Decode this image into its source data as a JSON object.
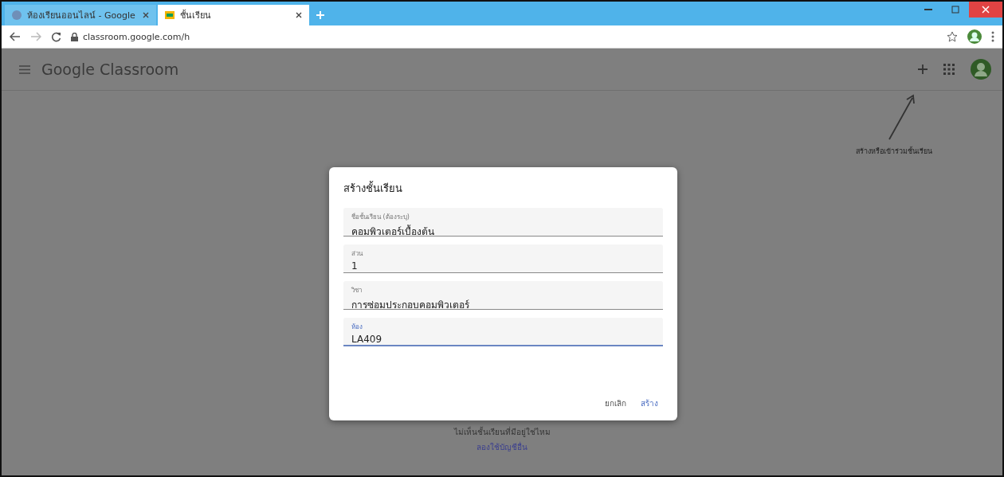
{
  "browser": {
    "tabs": [
      {
        "title": "ห้องเรียนออนไลน์ - Google",
        "selected": false
      },
      {
        "title": "ชั้นเรียน",
        "selected": true
      }
    ],
    "url": "classroom.google.com/h"
  },
  "app_bar": {
    "title": "Google Classroom"
  },
  "annotation": {
    "text": "สร้างหรือเข้าร่วมชั้นเรียน"
  },
  "empty_state": {
    "message": "ไม่เห็นชั้นเรียนที่มีอยู่ใช่ไหม",
    "link": "ลองใช้บัญชีอื่น"
  },
  "dialog": {
    "title": "สร้างชั้นเรียน",
    "fields": [
      {
        "label": "ชื่อชั้นเรียน (ต้องระบุ)",
        "value": "คอมพิวเตอร์เบื้องต้น",
        "focused": false
      },
      {
        "label": "ส่วน",
        "value": "1",
        "focused": false
      },
      {
        "label": "วิชา",
        "value": "การซ่อมประกอบคอมพิวเตอร์",
        "focused": false
      },
      {
        "label": "ห้อง",
        "value": "LA409",
        "focused": true
      }
    ],
    "buttons": [
      "ยกเลิก",
      "สร้าง"
    ]
  }
}
